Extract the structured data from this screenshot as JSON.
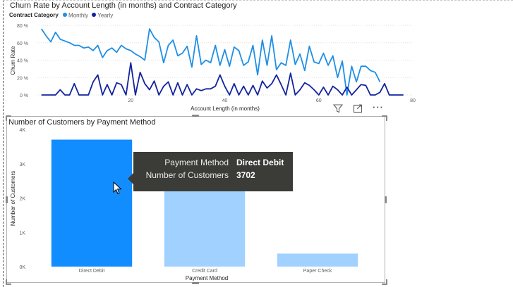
{
  "chart_data": [
    {
      "type": "line",
      "title": "Churn Rate by Account Length (in months) and Contract Category",
      "xlabel": "Account Length (in months)",
      "ylabel": "Churn Rate",
      "xlim": [
        0,
        80
      ],
      "ylim": [
        0,
        80
      ],
      "xticks": [
        "20",
        "40",
        "60",
        "80"
      ],
      "yticks": [
        "0 %",
        "20 %",
        "40 %",
        "60 %",
        "80 %"
      ],
      "grid": true,
      "legend": {
        "title": "Contract Category",
        "position": "top-left"
      },
      "series": [
        {
          "name": "Monthly",
          "color": "#1f8fe5",
          "x": [
            1,
            2,
            3,
            4,
            5,
            6,
            7,
            8,
            9,
            10,
            11,
            12,
            13,
            14,
            15,
            16,
            17,
            18,
            19,
            20,
            21,
            22,
            23,
            24,
            25,
            26,
            27,
            28,
            29,
            30,
            31,
            32,
            33,
            34,
            35,
            36,
            37,
            38,
            39,
            40,
            41,
            42,
            43,
            44,
            45,
            46,
            47,
            48,
            49,
            50,
            51,
            52,
            53,
            54,
            55,
            56,
            57,
            58,
            59,
            60,
            61,
            62,
            63,
            64,
            65,
            66,
            67,
            68,
            69,
            70,
            71,
            72,
            73
          ],
          "values": [
            76,
            68,
            61,
            72,
            64,
            62,
            60,
            57,
            57,
            54,
            55,
            51,
            57,
            43,
            51,
            54,
            49,
            57,
            53,
            51,
            47,
            44,
            40,
            76,
            66,
            61,
            37,
            57,
            63,
            45,
            48,
            56,
            32,
            68,
            35,
            40,
            37,
            57,
            34,
            52,
            33,
            55,
            51,
            34,
            38,
            57,
            23,
            63,
            34,
            68,
            29,
            37,
            34,
            63,
            35,
            47,
            28,
            56,
            38,
            36,
            48,
            34,
            45,
            20,
            39,
            0,
            33,
            15,
            33,
            33,
            28,
            26,
            15
          ],
          "extra": [
            {
              "x": 57,
              "y": 0
            },
            {
              "x": 59,
              "y": 0
            },
            {
              "x": 63,
              "y": 50
            },
            {
              "x": 64,
              "y": 26
            },
            {
              "x": 66,
              "y": 48
            },
            {
              "x": 68,
              "y": 0
            },
            {
              "x": 70,
              "y": 0
            },
            {
              "x": 71,
              "y": 25
            }
          ]
        },
        {
          "name": "Yearly",
          "color": "#12239e",
          "x": [
            1,
            2,
            3,
            4,
            5,
            6,
            7,
            8,
            9,
            10,
            11,
            12,
            13,
            14,
            15,
            16,
            17,
            18,
            19,
            20,
            21,
            22,
            23,
            24,
            25,
            26,
            27,
            28,
            29,
            30,
            31,
            32,
            33,
            34,
            35,
            36,
            37,
            38,
            39,
            40,
            41,
            42,
            43,
            44,
            45,
            46,
            47,
            48,
            49,
            50,
            51,
            52,
            53,
            54,
            55,
            56,
            57,
            58,
            59,
            60,
            61,
            62,
            63,
            64,
            65,
            66,
            67,
            68,
            69,
            70,
            71,
            72,
            73,
            74,
            75,
            76,
            77,
            78
          ],
          "values": [
            0,
            0,
            0,
            0,
            6,
            0,
            0,
            13,
            0,
            0,
            0,
            15,
            23,
            0,
            12,
            0,
            14,
            12,
            0,
            37,
            0,
            26,
            13,
            6,
            16,
            0,
            10,
            15,
            0,
            14,
            0,
            12,
            0,
            7,
            5,
            7,
            7,
            10,
            23,
            10,
            0,
            13,
            0,
            10,
            0,
            11,
            0,
            16,
            8,
            13,
            23,
            12,
            0,
            25,
            0,
            6,
            14,
            11,
            6,
            0,
            9,
            0,
            10,
            6,
            0,
            9,
            0,
            6,
            12,
            11,
            0,
            0,
            3,
            13,
            0,
            0,
            0,
            0
          ]
        }
      ]
    },
    {
      "type": "bar",
      "title": "Number of Customers by Payment Method",
      "xlabel": "Payment Method",
      "ylabel": "Number of Customers",
      "categories": [
        "Direct Debit",
        "Credit Card",
        "Paper Check"
      ],
      "values": [
        3702,
        2600,
        380
      ],
      "ylim": [
        0,
        4000
      ],
      "yticks": [
        "0K",
        "1K",
        "2K",
        "3K",
        "4K"
      ],
      "colors": [
        "#118dff",
        "#a0d1ff",
        "#a0d1ff"
      ],
      "highlighted_index": 0
    }
  ],
  "tooltip": {
    "rows": [
      {
        "key": "Payment Method",
        "value": "Direct Debit"
      },
      {
        "key": "Number of Customers",
        "value": "3702"
      }
    ]
  },
  "header_icons": [
    "filter-icon",
    "focus-mode-icon",
    "more-options-icon"
  ]
}
